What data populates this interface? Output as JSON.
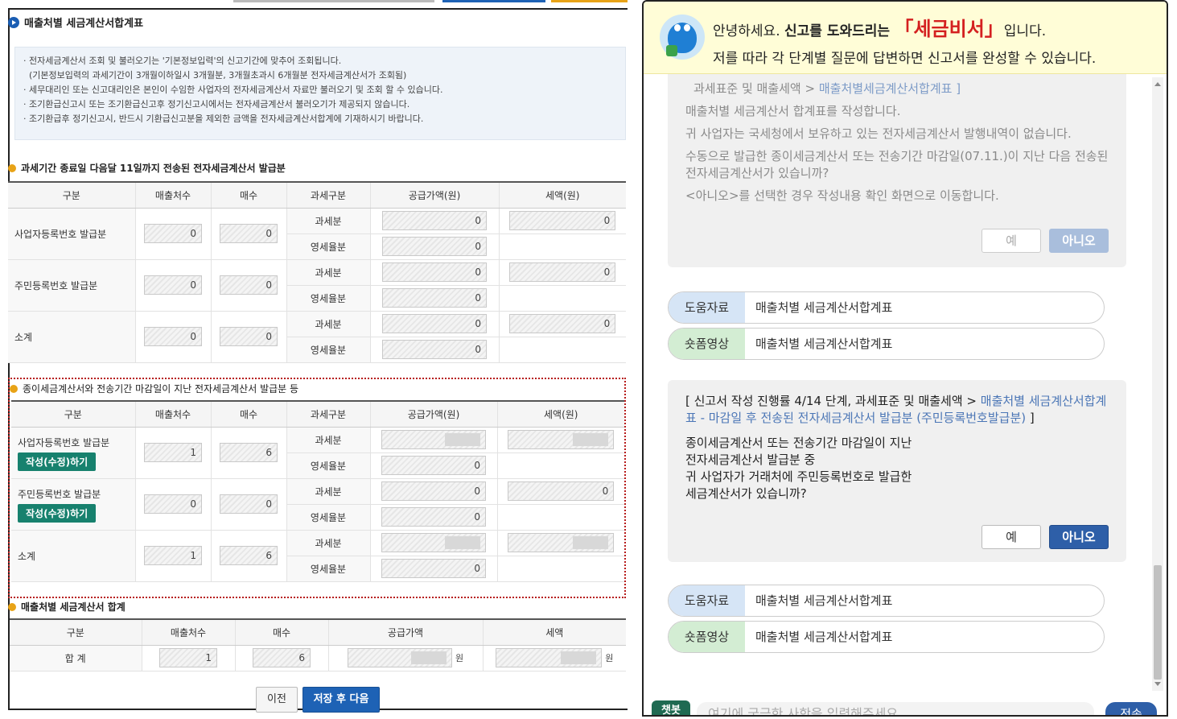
{
  "page": {
    "title": "매출처별 세금계산서합계표",
    "notices": [
      "전자세금계산서 조회 및 불러오기는 '기본정보입력'의 신고기간에 맞추어 조회됩니다.",
      "(기본정보입력의 과세기간이 3개월이하일시 3개월분, 3개월초과시 6개월분 전자세금계산서가 조회됨)",
      "세무대리인 또는 신고대리인은 본인이 수임한 사업자의 전자세금계산서 자료만 불러오기 및 조회 할 수 있습니다.",
      "조기환급신고시 또는 조기환급신고후 정기신고시에서는 전자세금계산서 불러오기가 제공되지 않습니다.",
      "조기환급후 정기신고시, 반드시 기환급신고분을 제외한 금액을 전자세금계산서합계에 기재하시기 바랍니다."
    ]
  },
  "section1": {
    "title": "과세기간 종료일 다음달 11일까지 전송된 전자세금계산서 발급분",
    "headers": [
      "구분",
      "매출처수",
      "매수",
      "과세구분",
      "공급가액(원)",
      "세액(원)"
    ],
    "rows": [
      {
        "label": "사업자등록번호 발급분",
        "customers": "0",
        "count": "0",
        "tax_type": "과세분",
        "supply": "0",
        "tax": "0",
        "zero_type": "영세율분",
        "zero_supply": "0"
      },
      {
        "label": "주민등록번호 발급분",
        "customers": "0",
        "count": "0",
        "tax_type": "과세분",
        "supply": "0",
        "tax": "0",
        "zero_type": "영세율분",
        "zero_supply": "0"
      },
      {
        "label": "소계",
        "customers": "0",
        "count": "0",
        "tax_type": "과세분",
        "supply": "0",
        "tax": "0",
        "zero_type": "영세율분",
        "zero_supply": "0"
      }
    ]
  },
  "section2": {
    "title": "종이세금계산서와 전송기간 마감일이 지난 전자세금계산서 발급분 등",
    "headers": [
      "구분",
      "매출처수",
      "매수",
      "과세구분",
      "공급가액(원)",
      "세액(원)"
    ],
    "write_button": "작성(수정)하기",
    "rows": [
      {
        "label": "사업자등록번호 발급분",
        "customers": "1",
        "count": "6",
        "tax_type": "과세분",
        "supply": "",
        "tax": "",
        "zero_type": "영세율분",
        "zero_supply": "0"
      },
      {
        "label": "주민등록번호 발급분",
        "customers": "0",
        "count": "0",
        "tax_type": "과세분",
        "supply": "0",
        "tax": "0",
        "zero_type": "영세율분",
        "zero_supply": "0"
      },
      {
        "label": "소계",
        "customers": "1",
        "count": "6",
        "tax_type": "과세분",
        "supply": "",
        "tax": "",
        "zero_type": "영세율분",
        "zero_supply": "0"
      }
    ]
  },
  "section3": {
    "title": "매출처별 세금계산서 합계",
    "headers": [
      "구분",
      "매출처수",
      "매수",
      "공급가액",
      "세액"
    ],
    "row": {
      "label": "합 계",
      "customers": "1",
      "count": "6",
      "supply": "",
      "tax": "",
      "unit": "원"
    }
  },
  "buttons": {
    "prev": "이전",
    "save_next": "저장 후 다음"
  },
  "chat": {
    "greeting_pre": "안녕하세요.",
    "greeting_bold": "신고를 도와드리는",
    "brand": "「세금비서」",
    "greeting_post": "입니다.",
    "greeting_line2": "저를 따라 각 단계별 질문에 답변하면 신고서를 완성할 수 있습니다.",
    "msg1": {
      "path_prefix": "과세표준 및 매출세액 > ",
      "path_link": "매출처별세금계산서합계표 ]",
      "line1": "매출처별 세금계산서 합계표를 작성합니다.",
      "line2": "귀 사업자는 국세청에서 보유하고 있는 전자세금계산서 발행내역이 없습니다.",
      "line3": "수동으로 발급한 종이세금계산서 또는 전송기간 마감일(07.11.)이 지난 다음 전송된 전자세금계산서가 있습니까?",
      "line4": "<아니오>를 선택한 경우 작성내용 확인 화면으로 이동합니다.",
      "yes": "예",
      "no": "아니오"
    },
    "links1": {
      "help_tag": "도움자료",
      "help_text": "매출처별 세금계산서합계표",
      "video_tag": "숏폼영상",
      "video_text": "매출처별 세금계산서합계표"
    },
    "msg2": {
      "path_prefix": "[ 신고서 작성 진행률 4/14 단계, 과세표준 및 매출세액 > ",
      "path_link": "매출처별 세금계산서합계표 - 마감일 후 전송된 전자세금계산서 발급분 (주민등록번호발급분)",
      "path_suffix": " ]",
      "body1": "종이세금계산서 또는 전송기간 마감일이 지난",
      "body2": "전자세금계산서 발급분 중",
      "body3": "귀 사업자가 거래처에 주민등록번호로 발급한",
      "body4": "세금계산서가 있습니까?",
      "yes": "예",
      "no": "아니오"
    },
    "links2": {
      "help_tag": "도움자료",
      "help_text": "매출처별 세금계산서합계표",
      "video_tag": "숏폼영상",
      "video_text": "매출처별 세금계산서합계표"
    },
    "chatbot_label": "챗봇",
    "input_placeholder": "여기에 궁금한 사항을 입력해주세요.",
    "send": "전송"
  },
  "colors": {
    "accent_blue": "#2e5fa8",
    "brand_red": "#d42020",
    "write_green": "#17816e",
    "dotted_red": "#b71c1c"
  }
}
